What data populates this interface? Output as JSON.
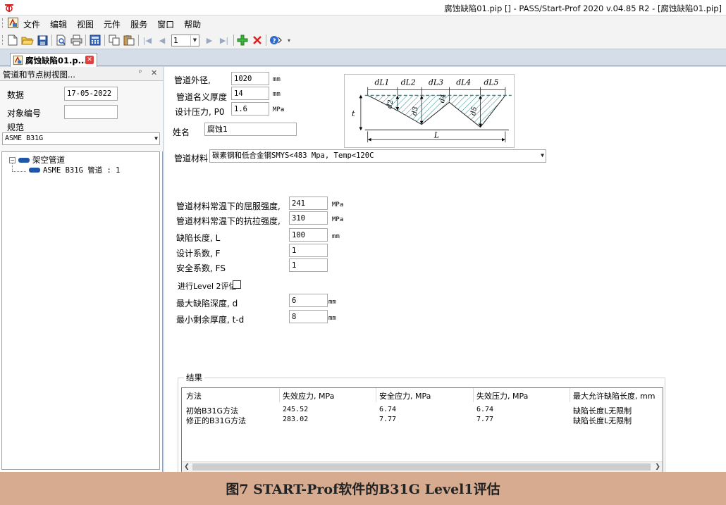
{
  "window": {
    "title": "腐蚀缺陷01.pip [] - PASS/Start-Prof 2020 v.04.85 R2 - [腐蚀缺陷01.pip]"
  },
  "menu": [
    "文件",
    "编辑",
    "视图",
    "元件",
    "服务",
    "窗口",
    "帮助"
  ],
  "toolbar": {
    "page_number": "1",
    "icons": [
      "new-file-icon",
      "open-folder-icon",
      "save-icon",
      "print-preview-icon",
      "print-icon",
      "calculator-icon",
      "copy-icon",
      "paste-icon",
      "first-page-icon",
      "prev-page-icon",
      "next-page-icon",
      "last-page-icon",
      "add-icon",
      "delete-icon",
      "help-icon"
    ]
  },
  "document_tab": {
    "label": "腐蚀缺陷01.p..."
  },
  "left_panel": {
    "title": "管道和节点树视图...",
    "data_label": "数据",
    "date_value": "17-05-2022",
    "object_id_label": "对象编号",
    "object_id_value": "",
    "code_label": "规范",
    "code_value": "ASME B31G",
    "tree": {
      "root_label": "架空管道",
      "child_label": "ASME B31G 管道 : 1"
    }
  },
  "form": {
    "outer_diameter": {
      "label": "管道外径,",
      "value": "1020",
      "unit": "mm"
    },
    "nominal_thickness": {
      "label": "管道名义厚度",
      "value": "14",
      "unit": "mm"
    },
    "design_pressure": {
      "label": "设计压力, P0",
      "value": "1.6",
      "unit": "MPa"
    },
    "name": {
      "label": "姓名",
      "value": "腐蚀1"
    },
    "material": {
      "label": "管道材料",
      "value": "碳素钢和低合金钢SMYS<483 Mpa, Temp<120C"
    },
    "yield_strength": {
      "label": "管道材料常温下的屈服强度,",
      "value": "241",
      "unit": "MPa"
    },
    "tensile_strength": {
      "label": "管道材料常温下的抗拉强度,",
      "value": "310",
      "unit": "MPa"
    },
    "defect_length": {
      "label": "缺陷长度, L",
      "value": "100",
      "unit": "mm"
    },
    "design_factor": {
      "label": "设计系数, F",
      "value": "1"
    },
    "safety_factor": {
      "label": "安全系数, FS",
      "value": "1"
    },
    "level2": {
      "label": "进行Level 2评估",
      "checked": false
    },
    "max_defect_depth": {
      "label": "最大缺陷深度, d",
      "value": "6",
      "unit": "mm"
    },
    "min_remaining_thickness": {
      "label": "最小剩余厚度, t-d",
      "value": "8",
      "unit": "mm"
    }
  },
  "diagram": {
    "top_labels": [
      "dL1",
      "dL2",
      "dL3",
      "dL4",
      "dL5"
    ],
    "depth_labels": [
      "d2",
      "d3",
      "d4",
      "d5"
    ],
    "thickness_label": "t",
    "length_label": "L"
  },
  "results": {
    "group_label": "结果",
    "columns": [
      "方法",
      "失效应力, MPa",
      "安全应力, MPa",
      "失效压力, MPa",
      "最大允许缺陷长度, mm"
    ],
    "rows": [
      [
        "初始B31G方法",
        "245.52",
        "6.74",
        "6.74",
        "缺陷长度L无限制"
      ],
      [
        "修正的B31G方法",
        "283.02",
        "7.77",
        "7.77",
        "缺陷长度L无限制"
      ]
    ]
  },
  "caption": "图7 START-Prof软件的B31G Level1评估"
}
